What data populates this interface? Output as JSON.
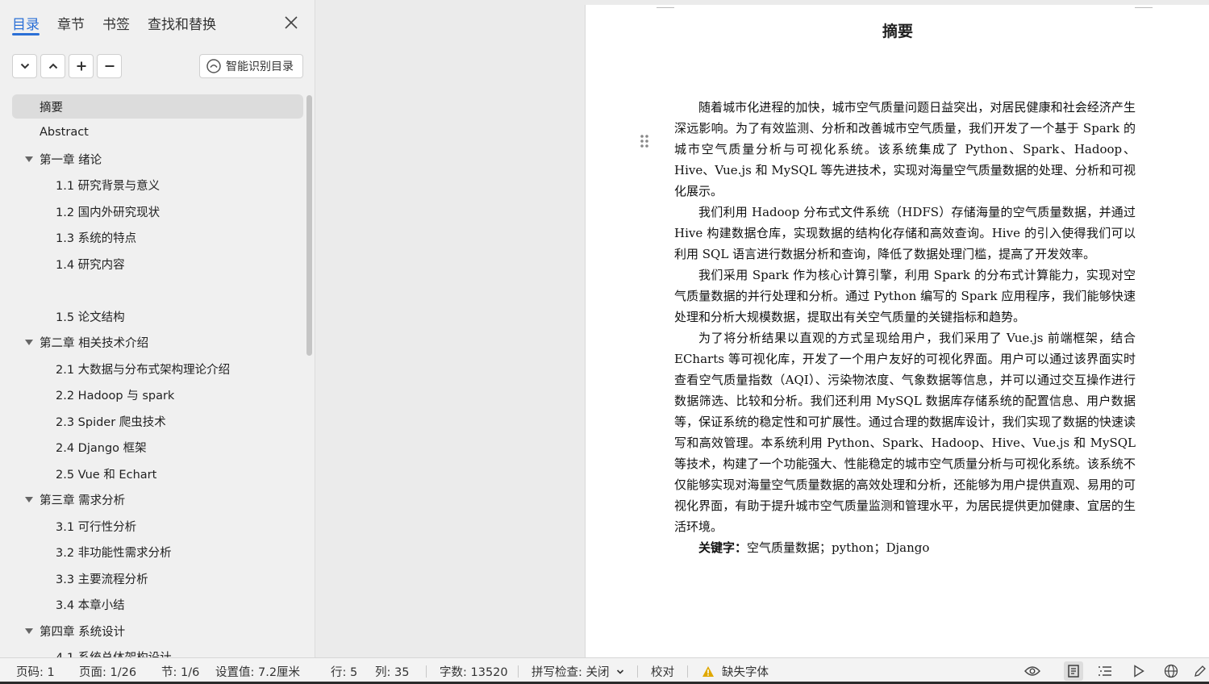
{
  "nav": {
    "tabs": [
      "目录",
      "章节",
      "书签",
      "查找和替换"
    ],
    "smart_toc_label": "智能识别目录",
    "toc": [
      {
        "label": "摘要",
        "selected": true
      },
      {
        "label": "Abstract"
      },
      {
        "label": "第一章 绪论"
      },
      {
        "label": "1.1 研究背景与意义"
      },
      {
        "label": "1.2 国内外研究现状"
      },
      {
        "label": "1.3 系统的特点"
      },
      {
        "label": "1.4 研究内容"
      },
      {
        "label": "1.5 论文结构"
      },
      {
        "label": "第二章 相关技术介绍"
      },
      {
        "label": "2.1 大数据与分布式架构理论介绍"
      },
      {
        "label": "2.2 Hadoop 与 spark"
      },
      {
        "label": "2.3 Spider 爬虫技术"
      },
      {
        "label": "2.4 Django 框架"
      },
      {
        "label": "2.5 Vue 和 Echart"
      },
      {
        "label": "第三章 需求分析"
      },
      {
        "label": "3.1 可行性分析"
      },
      {
        "label": "3.2 非功能性需求分析"
      },
      {
        "label": "3.3 主要流程分析"
      },
      {
        "label": "3.4 本章小结"
      },
      {
        "label": "第四章 系统设计"
      },
      {
        "label": "4.1 系统总体架构设计"
      }
    ]
  },
  "document": {
    "title": "摘要",
    "paragraphs": [
      "随着城市化进程的加快，城市空气质量问题日益突出，对居民健康和社会经济产生深远影响。为了有效监测、分析和改善城市空气质量，我们开发了一个基于 Spark 的城市空气质量分析与可视化系统。该系统集成了 Python、Spark、Hadoop、Hive、Vue.js 和 MySQL 等先进技术，实现对海量空气质量数据的处理、分析和可视化展示。",
      "我们利用 Hadoop 分布式文件系统（HDFS）存储海量的空气质量数据，并通过 Hive 构建数据仓库，实现数据的结构化存储和高效查询。Hive 的引入使得我们可以利用 SQL 语言进行数据分析和查询，降低了数据处理门槛，提高了开发效率。",
      "我们采用 Spark 作为核心计算引擎，利用 Spark 的分布式计算能力，实现对空气质量数据的并行处理和分析。通过 Python 编写的 Spark 应用程序，我们能够快速处理和分析大规模数据，提取出有关空气质量的关键指标和趋势。",
      "为了将分析结果以直观的方式呈现给用户，我们采用了 Vue.js 前端框架，结合 ECharts 等可视化库，开发了一个用户友好的可视化界面。用户可以通过该界面实时查看空气质量指数（AQI）、污染物浓度、气象数据等信息，并可以通过交互操作进行数据筛选、比较和分析。我们还利用 MySQL 数据库存储系统的配置信息、用户数据等，保证系统的稳定性和可扩展性。通过合理的数据库设计，我们实现了数据的快速读写和高效管理。本系统利用 Python、Spark、Hadoop、Hive、Vue.js 和 MySQL 等技术，构建了一个功能强大、性能稳定的城市空气质量分析与可视化系统。该系统不仅能够实现对海量空气质量数据的高效处理和分析，还能够为用户提供直观、易用的可视化界面，有助于提升城市空气质量监测和管理水平，为居民提供更加健康、宜居的生活环境。"
    ],
    "keywords_label": "关键字：",
    "keywords": "空气质量数据；python；Django"
  },
  "status": {
    "page_num": "页码: 1",
    "page_of": "页面: 1/26",
    "section": "节: 1/6",
    "setting": "设置值: 7.2厘米",
    "row": "行: 5",
    "col": "列: 35",
    "word_count": "字数: 13520",
    "spell_check": "拼写检查: 关闭",
    "proofread": "校对",
    "missing_font": "缺失字体"
  },
  "colors": {
    "accent": "#2a6fd6",
    "warning": "#e0a800"
  }
}
